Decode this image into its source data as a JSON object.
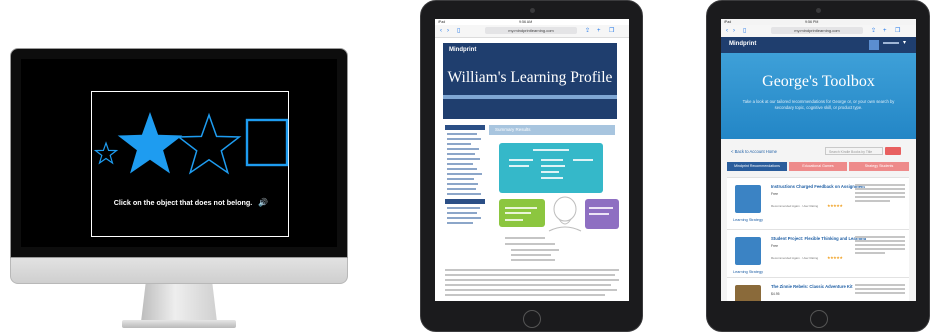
{
  "imac": {
    "instruction": "Click on the object that does not belong."
  },
  "ipad_left": {
    "status_left": "iPad",
    "status_time": "9:56 AM",
    "url": "my.mindprintlearning.com",
    "brand": "Mindprint",
    "profile_title": "William's Learning Profile",
    "summary_label": "Summary Results",
    "colors": {
      "header": "#1f3e6e",
      "teal": "#35b8c9",
      "green": "#8cc63f",
      "purple": "#8e6fc2"
    }
  },
  "ipad_right": {
    "status_left": "iPad",
    "status_time": "9:56 PM",
    "url": "my.mindprintlearning.com",
    "brand": "Mindprint",
    "toolbox_title": "George's Toolbox",
    "subtitle_text": "Take a look at our tailored recommendations for George or, or your own search by\nsecondary topic, cognitive skill, or product type.",
    "back_link": "< Back to Account Home",
    "search_placeholder": "Search Kindle Books by Title",
    "tabs": [
      {
        "label": "Mindprint Recommendations"
      },
      {
        "label": "Educational Games"
      },
      {
        "label": "Strategy Students"
      }
    ],
    "cards": [
      {
        "title": "Instructions Charged Feedback on Assignment",
        "category": "Learning Strategy",
        "tag": "Free",
        "meta": "Recommended Again  ·  User Rating"
      },
      {
        "title": "Student Project: Flexible Thinking and Learning",
        "category": "Learning Strategy",
        "tag": "Free",
        "meta": "Recommended Again  ·  User Rating"
      },
      {
        "title": "The Zinnie Rebels: Classic Adventure Kit",
        "category": "",
        "tag": "$4.95",
        "meta": "Recommended Again  ·  Mindprint Rating"
      }
    ],
    "colors": {
      "header": "#1f3e6e",
      "hero": "#3ea0d8",
      "tab_active": "#2a5d9c",
      "tab_inactive": "#ee8b8b"
    }
  }
}
